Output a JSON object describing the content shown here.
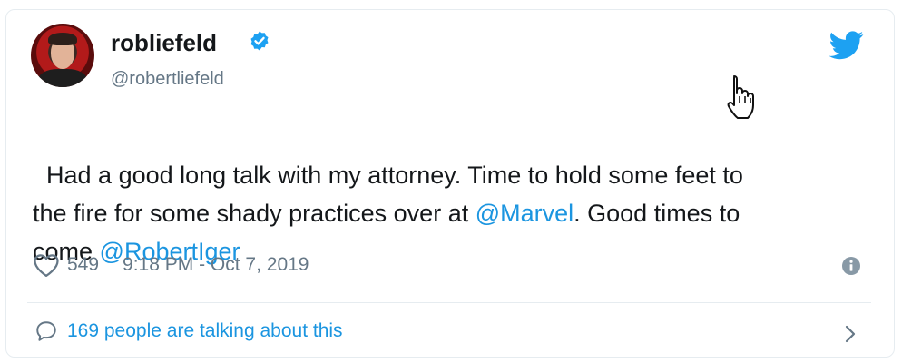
{
  "tweet": {
    "display_name": "robliefeld",
    "handle": "@robertliefeld",
    "verified": true,
    "text_parts": [
      {
        "text": "Had a good long talk with my attorney. Time to hold some feet to\nthe fire for some shady practices over at ",
        "mention": false
      },
      {
        "text": "@Marvel",
        "mention": true
      },
      {
        "text": ". Good times to\ncome ",
        "mention": false
      },
      {
        "text": "@RobertIger",
        "mention": true
      }
    ],
    "likes": "549",
    "timestamp": "9:18 PM - Oct 7, 2019",
    "conversation_text": "169 people are talking about this"
  },
  "colors": {
    "accent": "#1b95e0",
    "text": "#14171a",
    "muted": "#657786",
    "border": "#e6ecf0"
  },
  "icons": {
    "verified": "verified-badge-icon",
    "brand": "twitter-bird-icon",
    "like": "heart-icon",
    "info": "info-icon",
    "reply": "comment-bubble-icon",
    "chevron": "chevron-right-icon",
    "cursor": "hand-pointer-icon"
  }
}
